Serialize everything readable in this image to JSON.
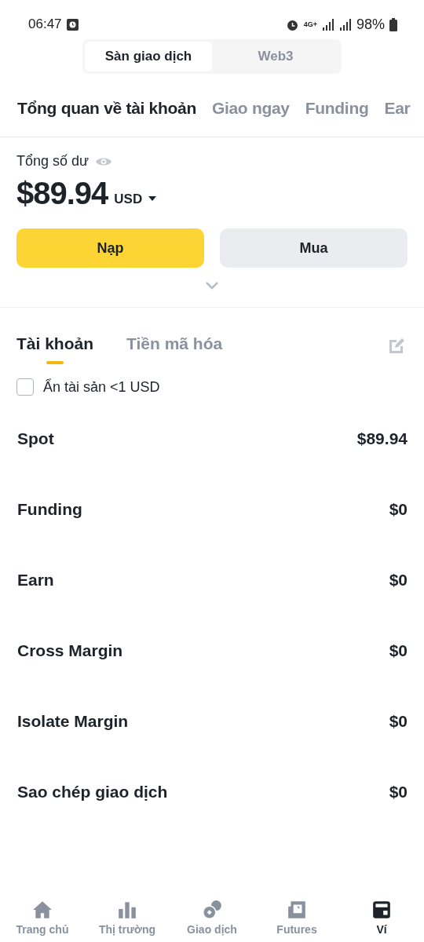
{
  "status_bar": {
    "time": "06:47",
    "network": "4G+",
    "battery": "98%"
  },
  "mode_switch": [
    {
      "label": "Sàn giao dịch",
      "selected": true
    },
    {
      "label": "Web3",
      "selected": false
    }
  ],
  "account_tabs": [
    {
      "label": "Tổng quan về tài khoản",
      "selected": true
    },
    {
      "label": "Giao ngay",
      "selected": false
    },
    {
      "label": "Funding",
      "selected": false
    },
    {
      "label": "Ear",
      "selected": false
    }
  ],
  "balance": {
    "label": "Tổng số dư",
    "amount": "$89.94",
    "currency": "USD"
  },
  "actions": [
    {
      "label": "Nạp",
      "kind": "primary"
    },
    {
      "label": "Mua",
      "kind": "secondary"
    }
  ],
  "sub_tabs": [
    {
      "label": "Tài khoản",
      "selected": true
    },
    {
      "label": "Tiền mã hóa",
      "selected": false
    }
  ],
  "hide_small": {
    "label": "Ẩn tài sản <1 USD",
    "checked": false
  },
  "accounts": [
    {
      "name": "Spot",
      "value": "$89.94"
    },
    {
      "name": "Funding",
      "value": "$0"
    },
    {
      "name": "Earn",
      "value": "$0"
    },
    {
      "name": "Cross Margin",
      "value": "$0"
    },
    {
      "name": "Isolate Margin",
      "value": "$0"
    },
    {
      "name": "Sao chép giao dịch",
      "value": "$0"
    }
  ],
  "bottom_nav": [
    {
      "label": "Trang chủ",
      "kind": "home",
      "selected": false
    },
    {
      "label": "Thị trường",
      "kind": "markets",
      "selected": false
    },
    {
      "label": "Giao dịch",
      "kind": "trade",
      "selected": false
    },
    {
      "label": "Futures",
      "kind": "futures",
      "selected": false
    },
    {
      "label": "Ví",
      "kind": "wallet",
      "selected": true
    }
  ]
}
